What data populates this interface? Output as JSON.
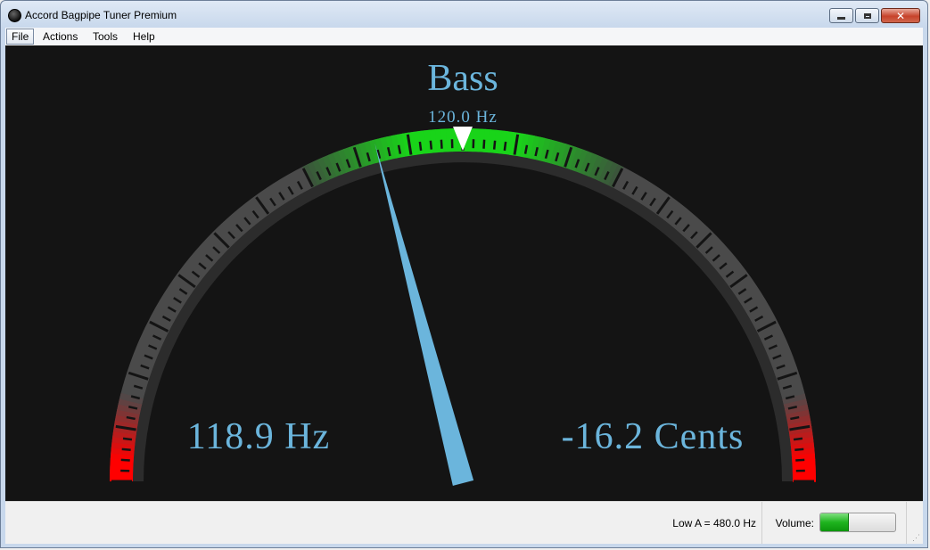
{
  "window": {
    "title": "Accord Bagpipe Tuner Premium",
    "icon": "bagpipe-app-icon",
    "controls": {
      "minimize": "minimize-icon",
      "maximize": "maximize-icon",
      "close": "close-icon"
    }
  },
  "menu": {
    "items": [
      {
        "label": "File"
      },
      {
        "label": "Actions"
      },
      {
        "label": "Tools"
      },
      {
        "label": "Help"
      }
    ]
  },
  "tuner": {
    "note_name": "Bass",
    "target_frequency": "120.0 Hz",
    "measured_frequency": "118.9 Hz",
    "cents_offset": "-16.2 Cents",
    "cents_value": -16.2,
    "scale_range_cents": [
      -100,
      100
    ],
    "colors": {
      "text": "#6bb5dc",
      "needle": "#6bb5dc",
      "in_tune_zone": "#19d419",
      "out_of_range_zone": "#ff0000",
      "dial": "#4a4a4a",
      "background": "#141414"
    }
  },
  "status": {
    "low_a": "Low A = 480.0 Hz",
    "volume_label": "Volume:",
    "volume_level": 0.38
  }
}
